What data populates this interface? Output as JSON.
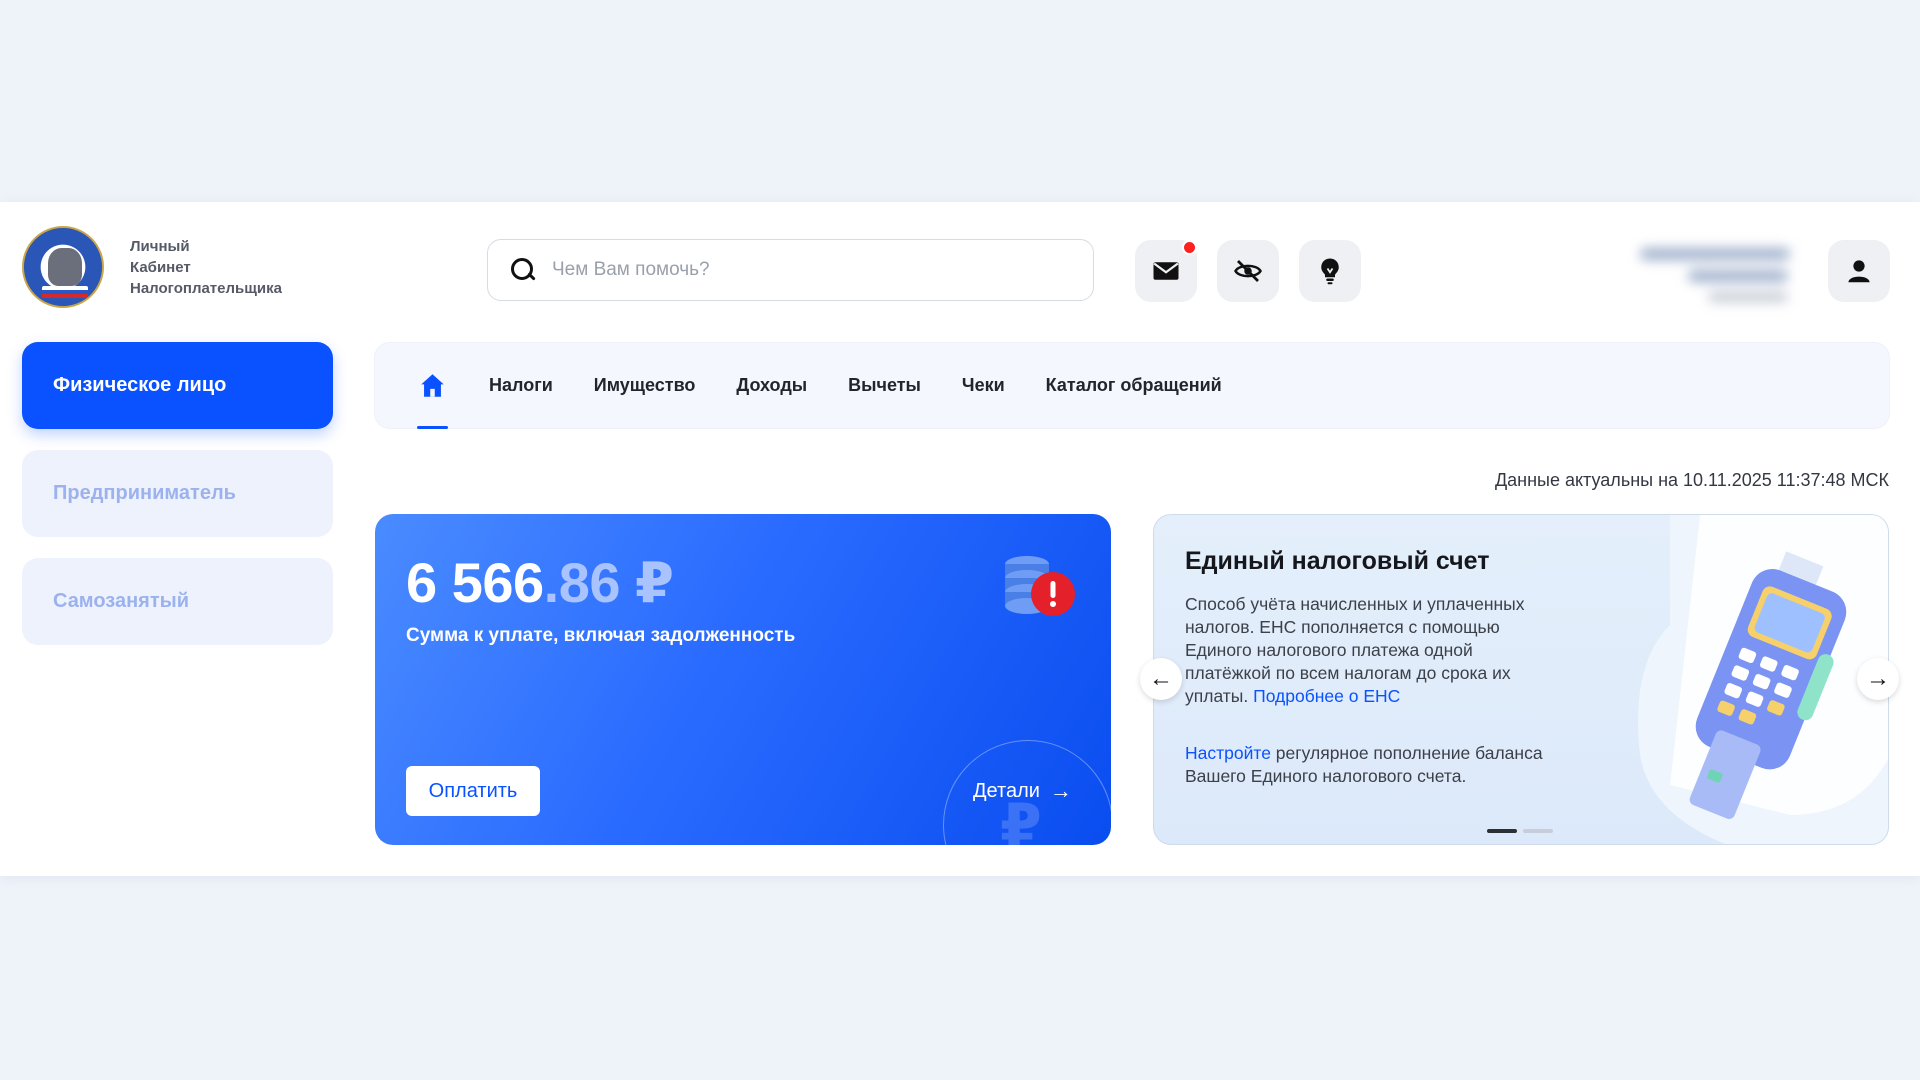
{
  "logo": {
    "line1": "Личный",
    "line2": "Кабинет",
    "line3": "Налогоплательщика"
  },
  "search": {
    "placeholder": "Чем Вам помочь?"
  },
  "header_icons": [
    "mail-icon",
    "eye-hidden-icon",
    "lightbulb-icon",
    "user-icon"
  ],
  "sidebar": {
    "items": [
      {
        "label": "Физическое лицо"
      },
      {
        "label": "Предприниматель"
      },
      {
        "label": "Самозанятый"
      }
    ]
  },
  "nav": {
    "items": [
      {
        "label": "Налоги"
      },
      {
        "label": "Имущество"
      },
      {
        "label": "Доходы"
      },
      {
        "label": "Вычеты"
      },
      {
        "label": "Чеки"
      },
      {
        "label": "Каталог обращений"
      }
    ]
  },
  "status": {
    "data_date": "Данные актуальны на 10.11.2025 11:37:48 МСК"
  },
  "debt": {
    "amount_int": "6 566",
    "amount_frac": ".86 ₽",
    "label": "Сумма к уплате, включая задолженность",
    "pay_label": "Оплатить",
    "details_label": "Детали",
    "watermark": "₽"
  },
  "ens": {
    "title": "Единый налоговый счет",
    "desc": "Способ учёта начисленных и уплаченных налогов. ЕНС пополняется с помощью Единого налогового платежа одной платёжкой по всем налогам до срока их уплаты.",
    "more_link": "Подробнее о ЕНС",
    "setup_link": "Настройте",
    "setup_text": " регулярное пополнение баланса Вашего Единого налогового счета."
  },
  "colors": {
    "accent": "#0a52ff",
    "alert": "#e4202b"
  }
}
